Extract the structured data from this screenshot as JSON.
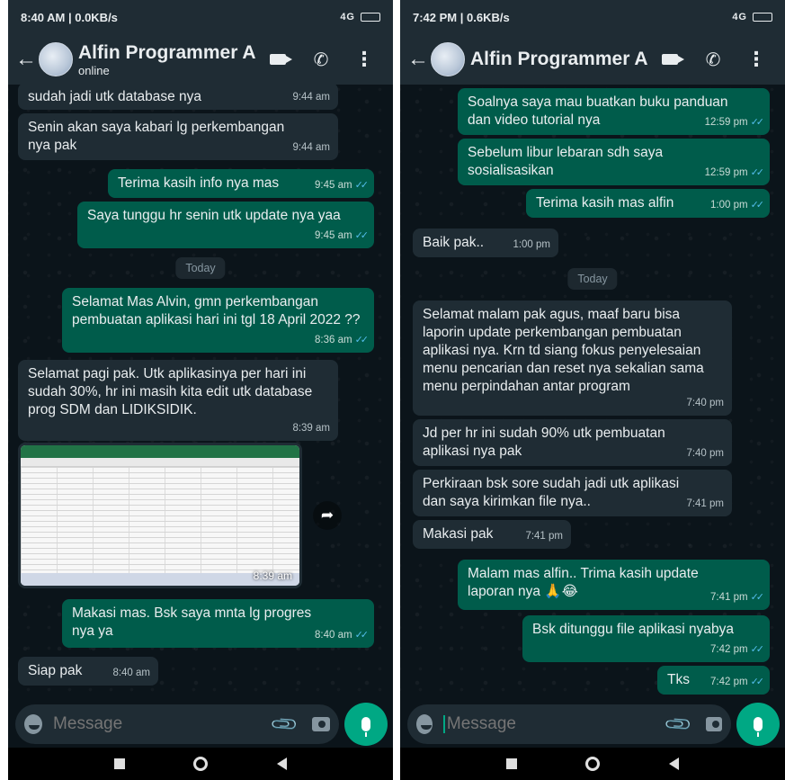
{
  "colors": {
    "incoming_bubble": "#1f2c34",
    "outgoing_bubble": "#005c4b",
    "read_ticks": "#53bdeb",
    "mic_button": "#00a884",
    "header": "#1f2c34"
  },
  "left": {
    "status": {
      "time": "8:40 AM | 0.0KB/s",
      "icons": "4G"
    },
    "header": {
      "name": "Alfin Programmer Ap...",
      "subtitle": "online"
    },
    "messages": [
      {
        "dir": "in",
        "text": "sudah jadi utk database nya",
        "time": "9:44 am"
      },
      {
        "dir": "in",
        "text": "Senin akan saya kabari lg perkembangan nya pak",
        "time": "9:44 am"
      },
      {
        "dir": "out",
        "text": "Terima kasih info nya mas",
        "time": "9:45 am"
      },
      {
        "dir": "out",
        "text": "Saya tunggu hr senin utk update nya yaa",
        "time": "9:45 am"
      },
      {
        "dir": "out",
        "text": "Selamat Mas Alvin, gmn perkembangan pembuatan aplikasi hari ini tgl 18 April 2022 ??",
        "time": "8:36 am"
      },
      {
        "dir": "in",
        "text": "Selamat pagi pak. Utk aplikasinya per hari ini sudah 30%, hr ini masih kita edit utk database prog SDM dan LIDIKSIDIK.",
        "time": "8:39 am"
      },
      {
        "dir": "out",
        "text": "Makasi mas. Bsk saya mnta lg progres nya ya",
        "time": "8:40 am"
      },
      {
        "dir": "in",
        "text": "Siap pak",
        "time": "8:40 am"
      }
    ],
    "day_divider": "Today",
    "image_message": {
      "time": "8:39 am",
      "icon": "forward-icon"
    },
    "composer": {
      "placeholder": "Message"
    }
  },
  "right": {
    "status": {
      "time": "7:42 PM | 0.6KB/s",
      "icons": "4G"
    },
    "header": {
      "name": "Alfin Programmer Ap..."
    },
    "messages": [
      {
        "dir": "out",
        "text": "Soalnya saya mau buatkan buku panduan dan video tutorial nya",
        "time": "12:59 pm"
      },
      {
        "dir": "out",
        "text": "Sebelum libur lebaran sdh saya sosialisasikan",
        "time": "12:59 pm"
      },
      {
        "dir": "out",
        "text": "Terima kasih mas alfin",
        "time": "1:00 pm"
      },
      {
        "dir": "in",
        "text": "Baik pak..",
        "time": "1:00 pm"
      },
      {
        "dir": "in",
        "text": "Selamat malam pak agus, maaf baru bisa laporin update perkembangan pembuatan aplikasi nya. Krn td siang fokus penyelesaian menu pencarian dan reset nya sekalian sama menu perpindahan antar program",
        "time": "7:40 pm"
      },
      {
        "dir": "in",
        "text": "Jd per hr ini sudah 90% utk pembuatan aplikasi nya pak",
        "time": "7:40 pm"
      },
      {
        "dir": "in",
        "text": "Perkiraan bsk sore sudah jadi utk aplikasi dan saya kirimkan file nya..",
        "time": "7:41 pm"
      },
      {
        "dir": "in",
        "text": "Makasi pak",
        "time": "7:41 pm"
      },
      {
        "dir": "out",
        "text": "Malam mas alfin.. Trima kasih update laporan nya 🙏😂",
        "time": "7:41 pm"
      },
      {
        "dir": "out",
        "text": "Bsk ditunggu file aplikasi nyabya",
        "time": "7:42 pm"
      },
      {
        "dir": "out",
        "text": "Tks",
        "time": "7:42 pm"
      }
    ],
    "day_divider": "Today",
    "composer": {
      "placeholder": "Message"
    }
  }
}
